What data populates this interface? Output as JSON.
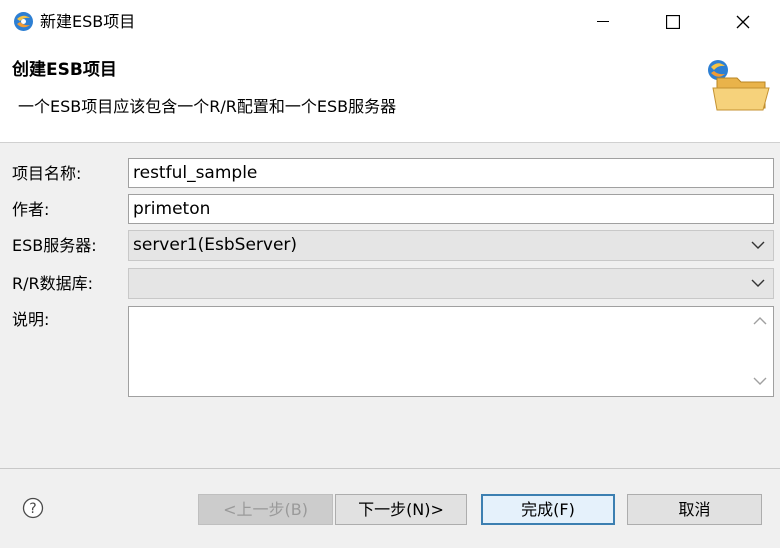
{
  "window": {
    "title": "新建ESB项目",
    "app_icon": "eclipse-esb-icon"
  },
  "banner": {
    "title": "创建ESB项目",
    "description": "一个ESB项目应该包含一个R/R配置和一个ESB服务器",
    "icon": "folder-icon"
  },
  "form": {
    "project_name_label": "项目名称:",
    "project_name_value": "restful_sample",
    "author_label": "作者:",
    "author_value": "primeton",
    "esb_server_label": "ESB服务器:",
    "esb_server_value": "server1(EsbServer)",
    "rr_db_label": "R/R数据库:",
    "rr_db_value": "",
    "description_label": "说明:",
    "description_value": ""
  },
  "footer": {
    "back_label": "<上一步(B)",
    "next_label": "下一步(N)>",
    "finish_label": "完成(F)",
    "cancel_label": "取消"
  },
  "colors": {
    "form_background": "#f0f0f0",
    "focus_border": "#3c7fb1"
  }
}
